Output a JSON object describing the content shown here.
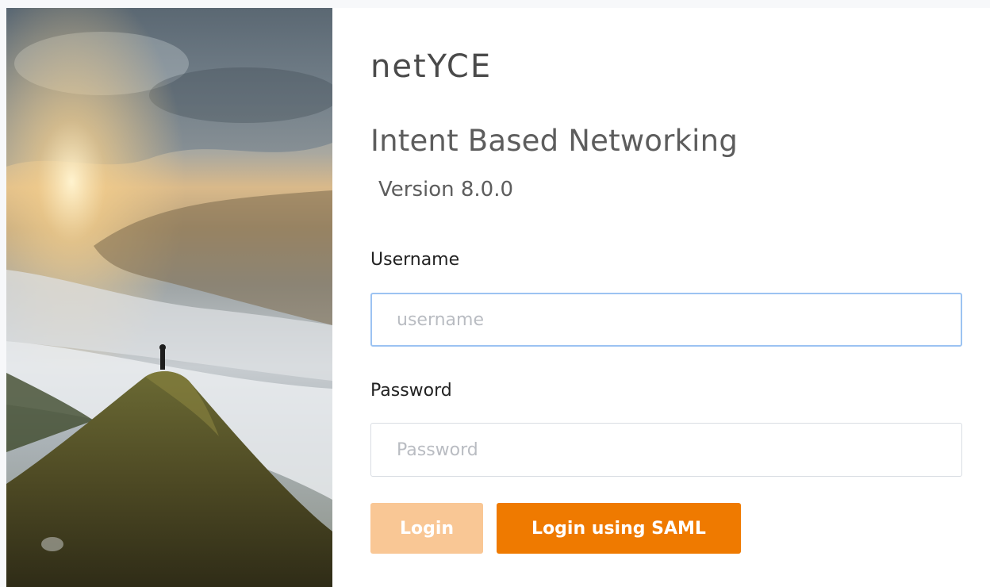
{
  "brand": {
    "logo_text": "netYCE"
  },
  "header": {
    "title": "Intent Based Networking",
    "version": "Version 8.0.0"
  },
  "form": {
    "username_label": "Username",
    "username_placeholder": "username",
    "username_value": "",
    "password_label": "Password",
    "password_placeholder": "Password",
    "password_value": "",
    "login_label": "Login",
    "saml_label": "Login using SAML"
  },
  "colors": {
    "accent": "#ef7a00",
    "accent_disabled": "#f9c795",
    "focus_border": "#9cc3f2",
    "text": "#5d5d5d"
  },
  "hero": {
    "image": "mountain-sunrise-photo"
  }
}
